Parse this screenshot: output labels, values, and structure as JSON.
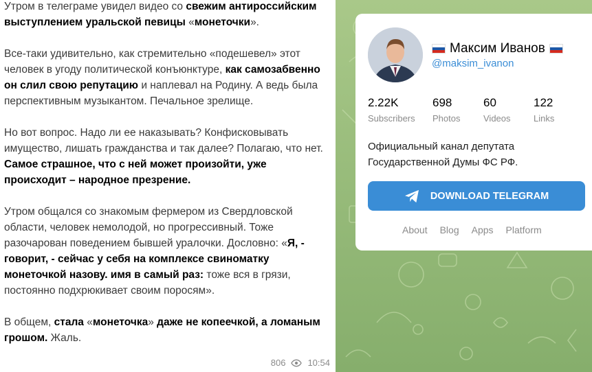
{
  "post": {
    "paragraphs": [
      [
        {
          "t": "Утром в телеграме увидел видео со ",
          "b": false
        },
        {
          "t": "свежим антироссийским выступлением уральской певицы",
          "b": true
        },
        {
          "t": " «",
          "b": false
        },
        {
          "t": "монеточки",
          "b": true
        },
        {
          "t": "».",
          "b": false
        }
      ],
      [
        {
          "t": "Все-таки удивительно, как стремительно «подешевел» этот человек в угоду политической конъюнктуре, ",
          "b": false
        },
        {
          "t": "как самозабвенно он слил свою репутацию",
          "b": true
        },
        {
          "t": " и наплевал на Родину. А ведь была перспективным музыкантом. Печальное зрелище.",
          "b": false
        }
      ],
      [
        {
          "t": "Но вот вопрос. Надо ли ее наказывать? Конфисковывать имущество, лишать гражданства и так далее? Полагаю, что нет. ",
          "b": false
        },
        {
          "t": "Самое страшное, что с ней может произойти, уже происходит – народное презрение.",
          "b": true
        }
      ],
      [
        {
          "t": "Утром общался со знакомым фермером из Свердловской области, человек немолодой, но прогрессивный. Тоже разочарован поведением бывшей уралочки. Дословно: «",
          "b": false
        },
        {
          "t": "Я, - говорит, - сейчас у себя на комплексе свиноматку монеточкой назову. имя в самый раз:",
          "b": true
        },
        {
          "t": " тоже вся в грязи, постоянно подхрюкивает своим поросям».",
          "b": false
        }
      ],
      [
        {
          "t": "В общем, ",
          "b": false
        },
        {
          "t": "стала",
          "b": true
        },
        {
          "t": " «",
          "b": false
        },
        {
          "t": "монеточка",
          "b": true
        },
        {
          "t": "» ",
          "b": false
        },
        {
          "t": "даже не копеечкой, а ломаным грошом.",
          "b": true
        },
        {
          "t": " Жаль.",
          "b": false
        }
      ]
    ],
    "views": "806",
    "time": "10:54",
    "views_icon": "eye-icon"
  },
  "channel": {
    "name": "Максим Иванов",
    "flag_icon": "russia-flag-icon",
    "handle": "@maksim_ivanon",
    "stats": [
      {
        "value": "2.22K",
        "label": "Subscribers"
      },
      {
        "value": "698",
        "label": "Photos"
      },
      {
        "value": "60",
        "label": "Videos"
      },
      {
        "value": "122",
        "label": "Links"
      }
    ],
    "description": "Официальный канал депутата Государственной Думы ФС РФ.",
    "download_label": "DOWNLOAD TELEGRAM",
    "download_icon": "telegram-plane-icon",
    "footer_links": [
      "About",
      "Blog",
      "Apps",
      "Platform"
    ]
  },
  "colors": {
    "accent": "#3a8dd6",
    "background_green": "#9cc07e"
  }
}
